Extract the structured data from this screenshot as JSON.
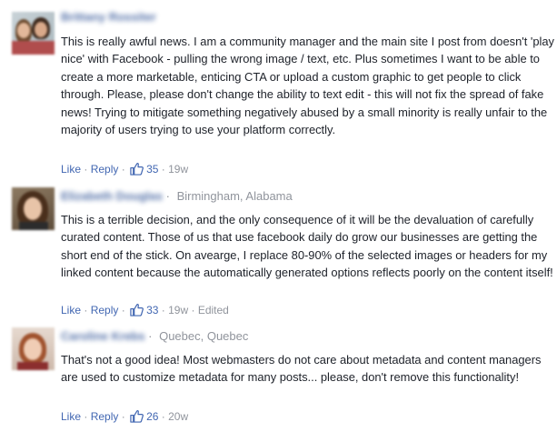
{
  "comments": [
    {
      "author": "Brittany Rossiter",
      "location": "",
      "text": "This is really awful news. I am a community manager and the main site I post from doesn't 'play nice' with Facebook - pulling the wrong image / text, etc. Plus sometimes I want to be able to create a more marketable, enticing CTA or upload a custom graphic to get people to click through. Please, please don't change the ability to text edit - this will not fix the spread of fake news! Trying to mitigate something negatively abused by a small minority is really unfair to the majority of users trying to use your platform correctly.",
      "like_label": "Like",
      "reply_label": "Reply",
      "like_count": "35",
      "time": "19w",
      "edited": ""
    },
    {
      "author": "Elizabeth Douglas",
      "location": "Birmingham, Alabama",
      "text": "This is a terrible decision, and the only consequence of it will be the devaluation of carefully curated content. Those of us that use facebook daily do grow our businesses are getting the short end of the stick. On avearge, I replace 80-90% of the selected images or headers for my linked content because the automatically generated options reflects poorly on the content itself!",
      "like_label": "Like",
      "reply_label": "Reply",
      "like_count": "33",
      "time": "19w",
      "edited": "Edited"
    },
    {
      "author": "Caroline Krebs",
      "location": "Quebec, Quebec",
      "text": "That's not a good idea! Most webmasters do not care about metadata and content managers are used to customize metadata for many posts... please, don't remove this functionality!",
      "like_label": "Like",
      "reply_label": "Reply",
      "like_count": "26",
      "time": "20w",
      "edited": ""
    }
  ],
  "separator": "·",
  "icons": {
    "like": "thumbs-up-icon"
  },
  "colors": {
    "link": "#4267b2",
    "name": "#365899",
    "meta": "#90949c",
    "text": "#1d2129"
  }
}
